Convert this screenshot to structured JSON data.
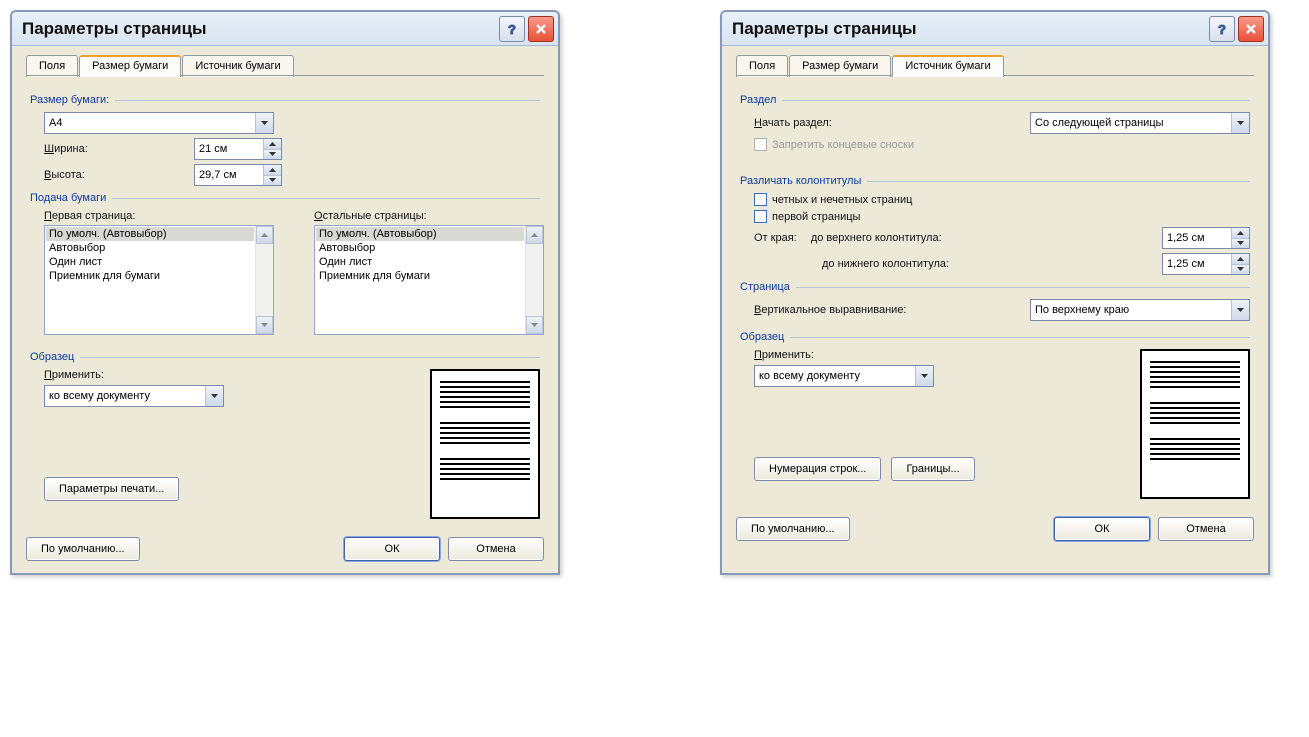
{
  "dialog_left": {
    "title": "Параметры страницы",
    "tabs": [
      "Поля",
      "Размер бумаги",
      "Источник бумаги"
    ],
    "active_tab_index": 1,
    "paper_size": {
      "group_label": "Размер бумаги:",
      "selected": "A4",
      "width_label": "Ширина:",
      "width_value": "21 см",
      "height_label": "Высота:",
      "height_value": "29,7 см"
    },
    "feed": {
      "group_label": "Подача бумаги",
      "first_page_label": "Первая страница:",
      "other_pages_label": "Остальные страницы:",
      "options": [
        "По умолч. (Автовыбор)",
        "Автовыбор",
        "Один лист",
        "Приемник для бумаги"
      ]
    },
    "sample": {
      "group_label": "Образец",
      "apply_label": "Применить:",
      "apply_value": "ко всему документу"
    },
    "print_options_button": "Параметры печати...",
    "default_button": "По умолчанию...",
    "ok_button": "ОК",
    "cancel_button": "Отмена"
  },
  "dialog_right": {
    "title": "Параметры страницы",
    "tabs": [
      "Поля",
      "Размер бумаги",
      "Источник бумаги"
    ],
    "active_tab_index": 2,
    "section": {
      "group_label": "Раздел",
      "start_label": "Начать раздел:",
      "start_value": "Со следующей страницы",
      "suppress_label": "Запретить концевые сноски"
    },
    "headers": {
      "group_label": "Различать колонтитулы",
      "odd_even_label": "четных и нечетных страниц",
      "first_page_label": "первой страницы",
      "from_edge_label": "От края:",
      "header_label": "до верхнего колонтитула:",
      "header_value": "1,25 см",
      "footer_label": "до нижнего колонтитула:",
      "footer_value": "1,25 см"
    },
    "page": {
      "group_label": "Страница",
      "valign_label": "Вертикальное выравнивание:",
      "valign_value": "По верхнему краю"
    },
    "sample": {
      "group_label": "Образец",
      "apply_label": "Применить:",
      "apply_value": "ко всему документу"
    },
    "line_numbers_button": "Нумерация строк...",
    "borders_button": "Границы...",
    "default_button": "По умолчанию...",
    "ok_button": "ОК",
    "cancel_button": "Отмена"
  }
}
